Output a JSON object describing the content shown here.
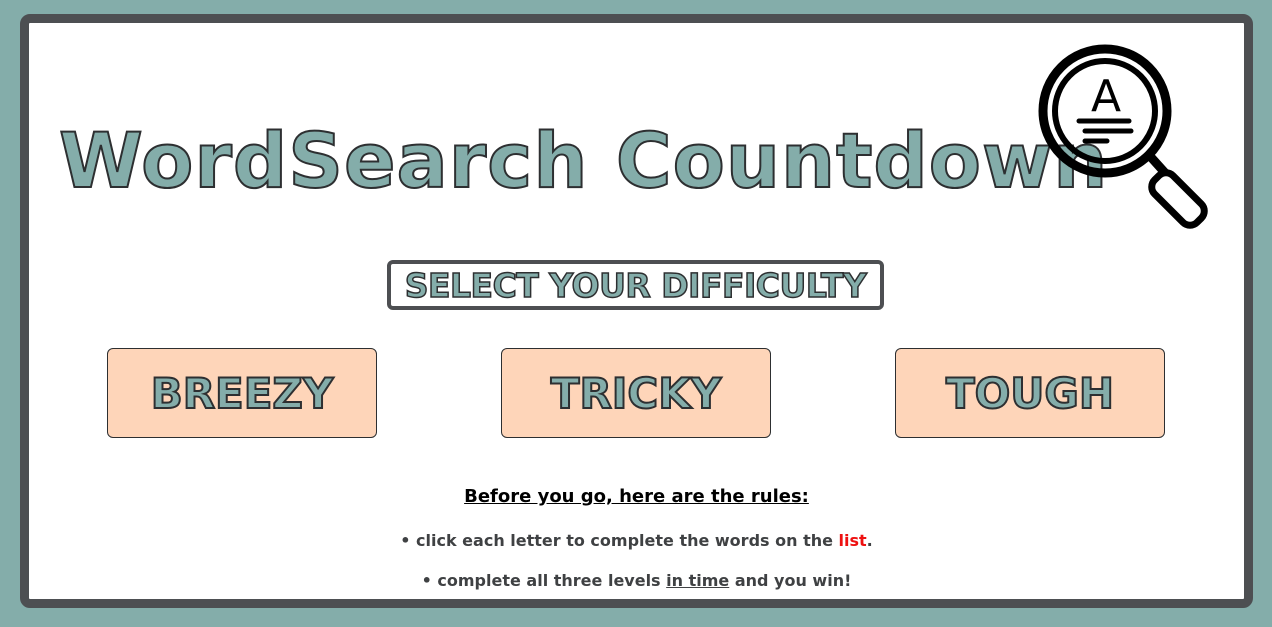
{
  "app": {
    "title": "WordSearch Countdown",
    "logo_icon": "magnifier-letter-a-icon",
    "logo_letter": "A"
  },
  "difficulty": {
    "heading": "SELECT YOUR DIFFICULTY",
    "buttons": [
      {
        "label": "BREEZY"
      },
      {
        "label": "TRICKY"
      },
      {
        "label": "TOUGH"
      }
    ]
  },
  "rules": {
    "heading": "Before you go, here are the rules:",
    "rule1": {
      "prefix": "• click each letter to complete the words on the ",
      "highlight": "list",
      "suffix": "."
    },
    "rule2": {
      "prefix": "• complete all three levels ",
      "underlined": "in time",
      "suffix": " and you win!"
    }
  },
  "colors": {
    "background": "#84ADAA",
    "frame_border": "#4d4f52",
    "button_fill": "#FED5B9",
    "title_fill": "#84ADAA",
    "highlight": "#ee1111"
  }
}
